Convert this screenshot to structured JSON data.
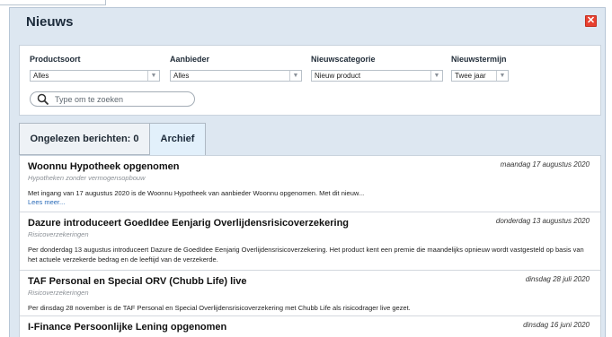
{
  "dialog": {
    "title": "Nieuws",
    "close_icon": "close-icon"
  },
  "filters": {
    "productsoort": {
      "label": "Productsoort",
      "value": "Alles"
    },
    "aanbieder": {
      "label": "Aanbieder",
      "value": "Alles"
    },
    "nieuwscategorie": {
      "label": "Nieuwscategorie",
      "value": "Nieuw product"
    },
    "nieuwstermijn": {
      "label": "Nieuwstermijn",
      "value": "Twee jaar"
    },
    "search": {
      "placeholder": "Type om te zoeken",
      "value": ""
    }
  },
  "tabs": {
    "unread": "Ongelezen berichten: 0",
    "archive": "Archief"
  },
  "news": [
    {
      "title": "Woonnu Hypotheek opgenomen",
      "date": "maandag 17 augustus 2020",
      "category": "Hypotheken zonder vermogensopbouw",
      "body": "Met ingang van 17 augustus 2020 is de Woonnu Hypotheek van aanbieder Woonnu opgenomen. Met dit nieuw...",
      "more": "Lees meer..."
    },
    {
      "title": "Dazure introduceert GoedIdee Eenjarig Overlijdensrisicoverzekering",
      "date": "donderdag 13 augustus 2020",
      "category": "Risicoverzekeringen",
      "body": "Per donderdag 13 augustus introduceert Dazure de GoedIdee Eenjarig Overlijdensrisicoverzekering. Het product kent een premie die maandelijks opnieuw wordt vastgesteld op basis van het actuele verzekerde bedrag en de leeftijd van de verzekerde."
    },
    {
      "title": "TAF Personal en Special ORV (Chubb Life) live",
      "date": "dinsdag 28 juli 2020",
      "category": "Risicoverzekeringen",
      "body": "Per dinsdag 28 november is de TAF Personal en Special Overlijdensrisicoverzekering met Chubb Life als risicodrager live gezet."
    },
    {
      "title": "I-Finance Persoonlijke Lening opgenomen",
      "date": "dinsdag 16 juni 2020"
    }
  ],
  "colors": {
    "dialog_bg": "#dde7f1",
    "close": "#e8402f",
    "link": "#2a6bb8",
    "active_tab": "#e2f0fb"
  }
}
